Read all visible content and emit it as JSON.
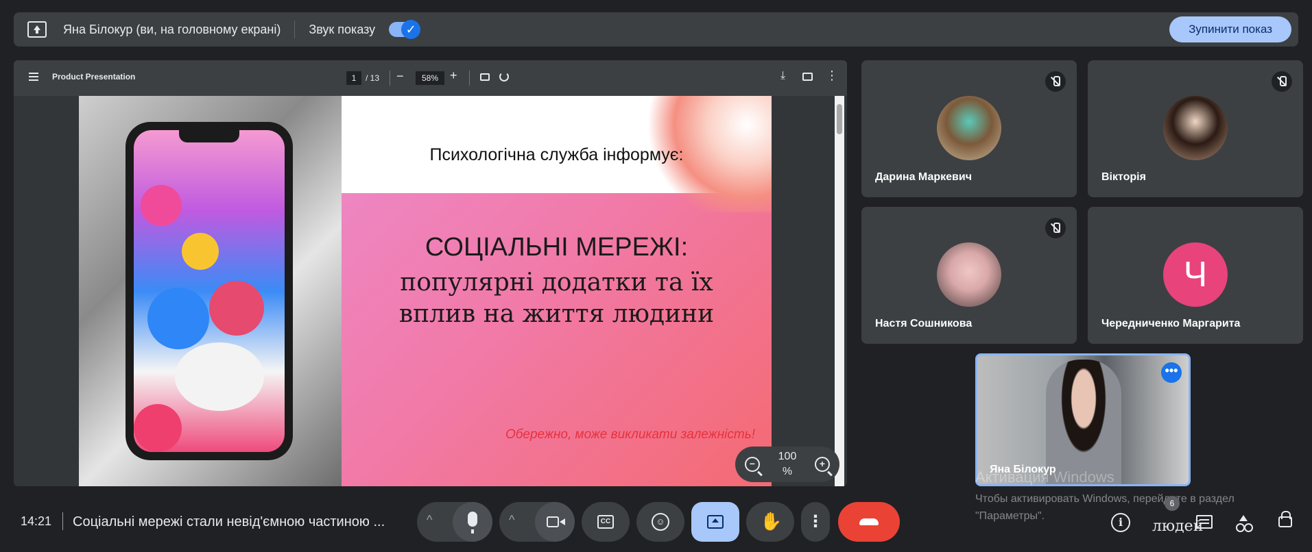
{
  "present_bar": {
    "presenter_label": "Яна Білокур (ви, на головному екрані)",
    "sound_label": "Звук показу",
    "sound_check": "✓",
    "stop_label": "Зупинити показ"
  },
  "pdf_viewer": {
    "title": "Product Presentation",
    "page_current": "1",
    "page_total": "/ 13",
    "zoom": "58%",
    "minus": "−",
    "plus": "+",
    "download_glyph": "⤓",
    "more_glyph": "⋮"
  },
  "slide": {
    "subtitle": "Психологічна служба інформує:",
    "heading": "СОЦІАЛЬНІ МЕРЕЖІ:",
    "line2": "популярні додатки та їх",
    "line3": "вплив на життя людини",
    "warning": "Обережно, може викликати залежність!"
  },
  "zoom_widget": {
    "value": "100\n%",
    "minus_glyph": "−",
    "plus_glyph": "+"
  },
  "participants": [
    {
      "name": "Дарина Маркевич",
      "muted": true
    },
    {
      "name": "Вікторія",
      "muted": true
    },
    {
      "name": "Настя Сошникова",
      "muted": true
    },
    {
      "name": "Чередниченко Маргарита",
      "muted": false,
      "initial": "Ч"
    }
  ],
  "self_view": {
    "name": "Яна Білокур",
    "more_glyph": "•••"
  },
  "windows_activation": {
    "title": "Активация Windows",
    "subtitle": "Чтобы активировать Windows, перейдите в раздел \"Параметры\"."
  },
  "bottom_bar": {
    "time": "14:21",
    "meeting_title": "Соціальні мережі стали невід'ємною частиною ...",
    "caret": "^",
    "cc_label": "CC",
    "emoji_glyph": "☺",
    "hand_glyph": "✋",
    "more_glyph": "⋮",
    "info_glyph": "i",
    "people_count": "6",
    "people_label": "людей"
  },
  "colors": {
    "accent": "#8ab4f8",
    "stop_button": "#a8c7fa",
    "hangup": "#ea4335",
    "avatar_letter_bg": "#e8437b",
    "surface": "#3c4043",
    "background": "#202124"
  }
}
